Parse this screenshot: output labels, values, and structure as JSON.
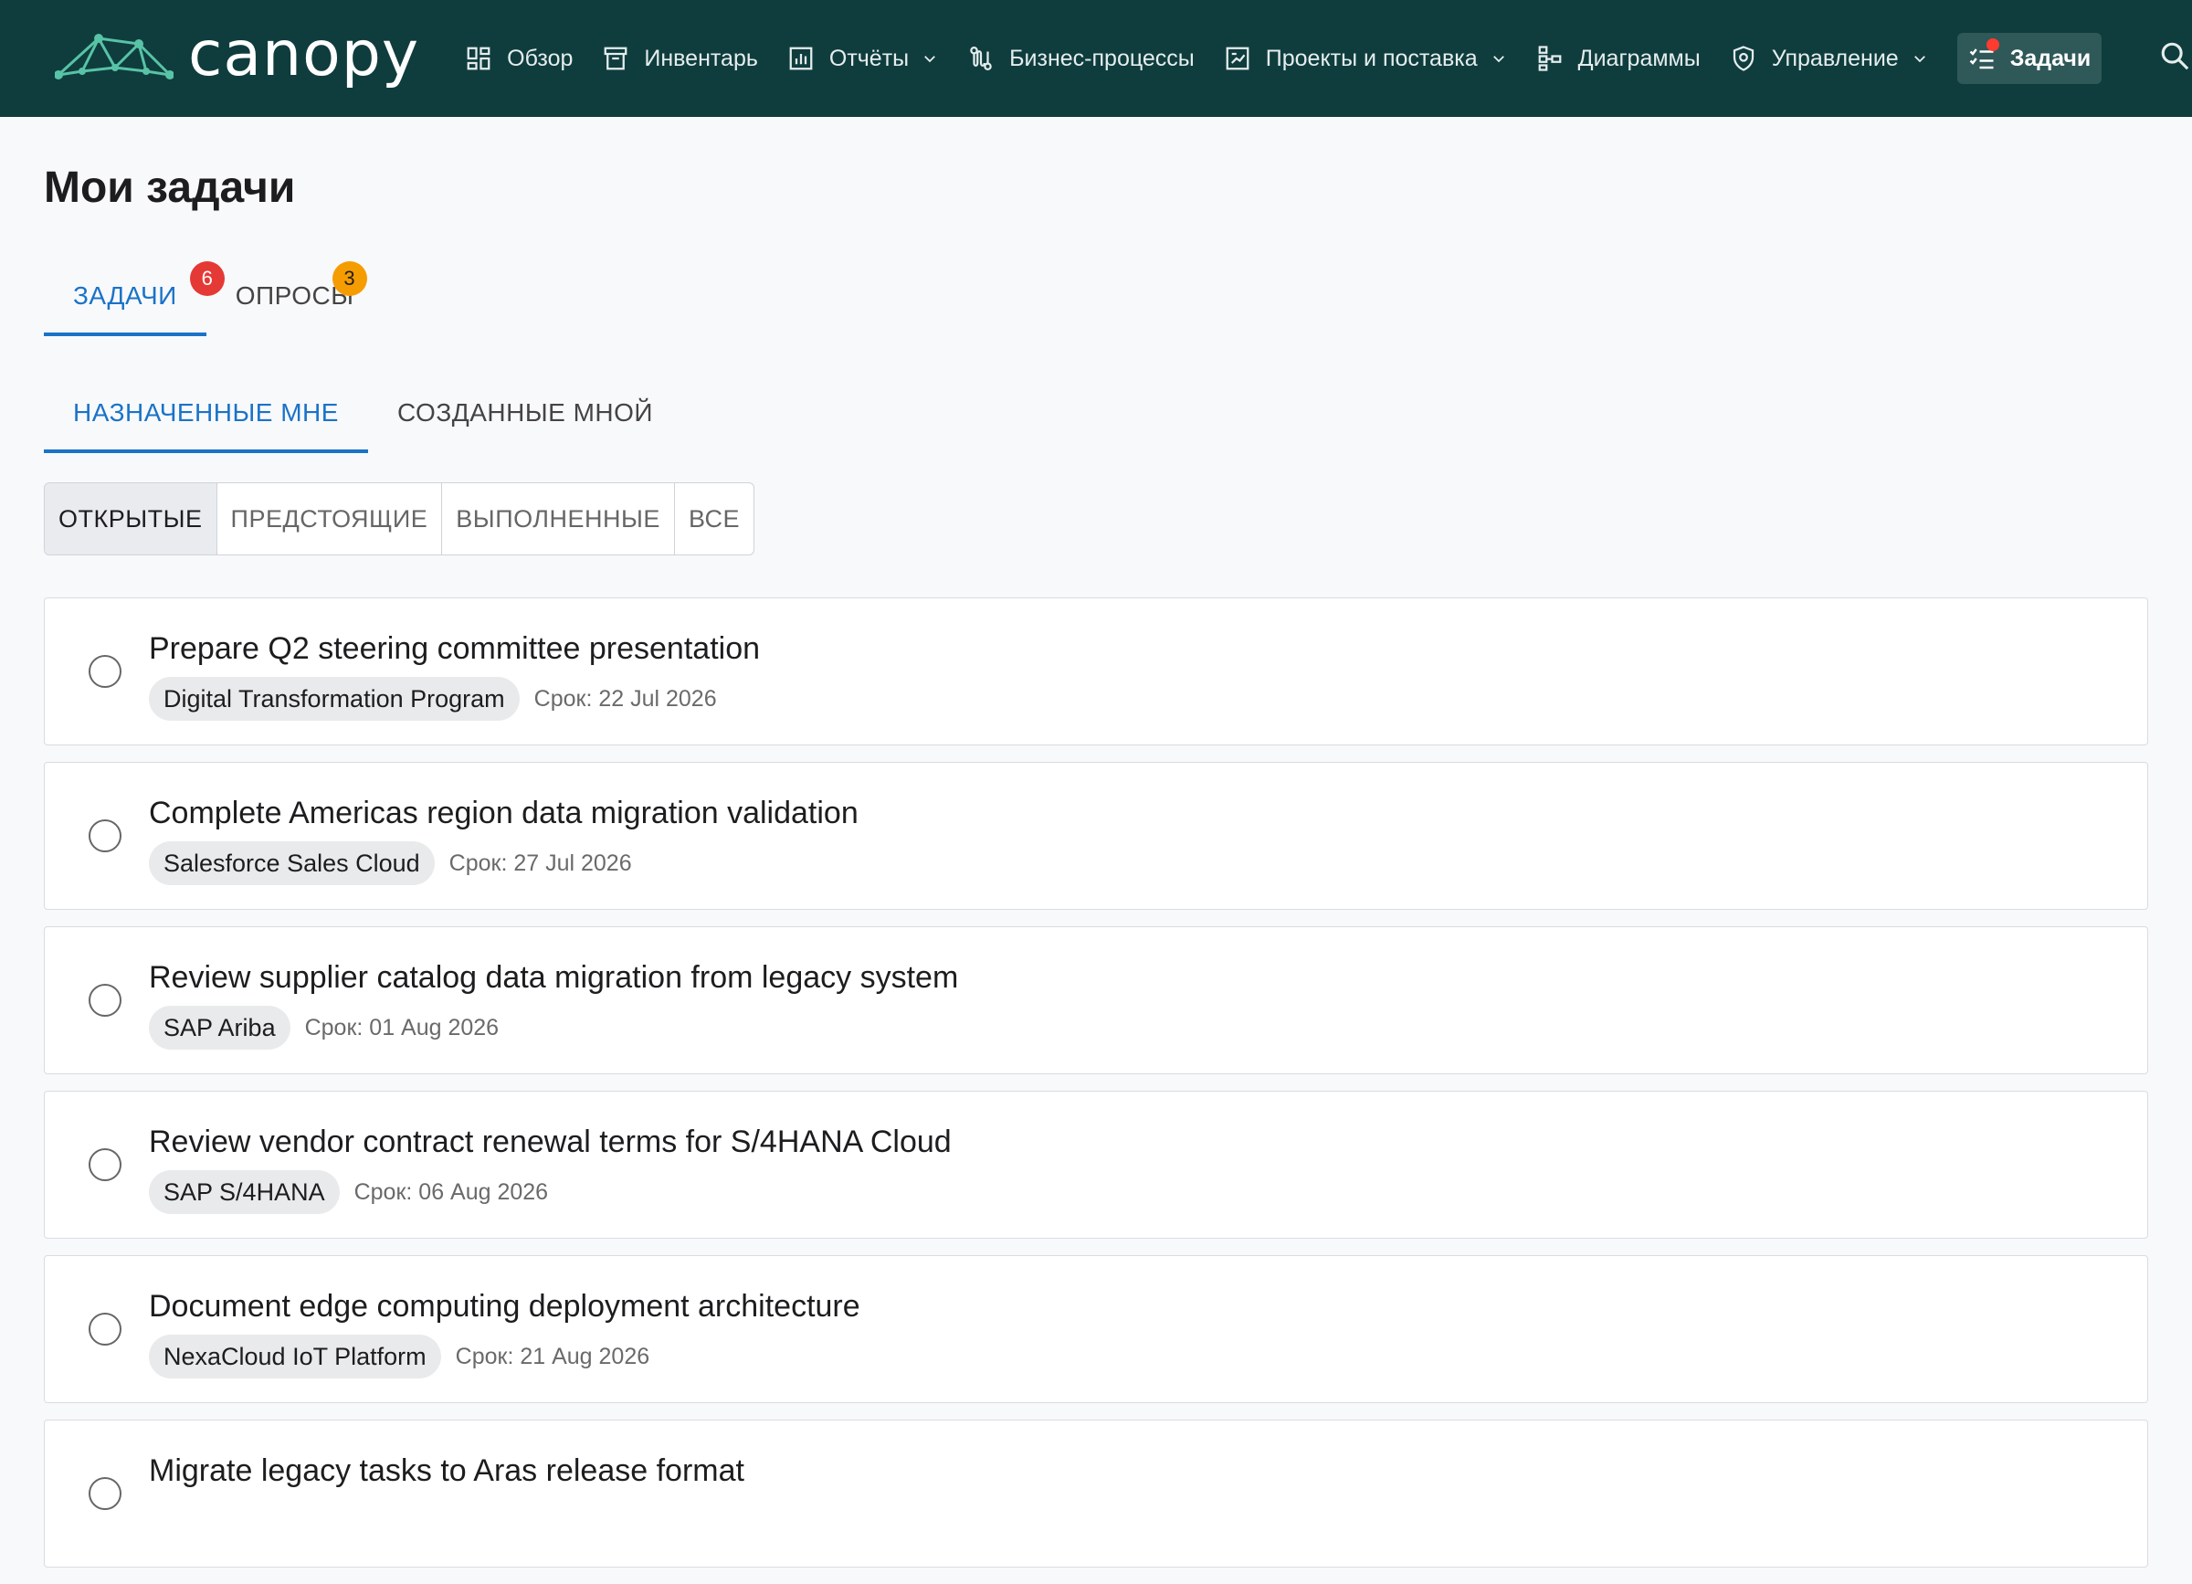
{
  "app": {
    "logo_text": "canopy"
  },
  "nav": {
    "items": [
      {
        "label": "Обзор",
        "icon": "dashboard-icon",
        "has_menu": false
      },
      {
        "label": "Инвентарь",
        "icon": "archive-box-icon",
        "has_menu": false
      },
      {
        "label": "Отчёты",
        "icon": "bar-chart-icon",
        "has_menu": true
      },
      {
        "label": "Бизнес-процессы",
        "icon": "process-flow-icon",
        "has_menu": false
      },
      {
        "label": "Проекты и поставка",
        "icon": "project-board-icon",
        "has_menu": true
      },
      {
        "label": "Диаграммы",
        "icon": "hierarchy-diagram-icon",
        "has_menu": false
      },
      {
        "label": "Управление",
        "icon": "shield-icon",
        "has_menu": true
      }
    ],
    "active": {
      "label": "Задачи",
      "icon": "task-list-icon",
      "notification": true
    },
    "search_icon": "search-icon",
    "colors": {
      "bar": "#0f3d3e",
      "active_bg": "#2f5859",
      "dot": "#ff3b30"
    }
  },
  "page": {
    "title": "Мои задачи"
  },
  "tabs": {
    "tasks": {
      "label": "ЗАДАЧИ",
      "badge": "6"
    },
    "surveys": {
      "label": "ОПРОСЫ",
      "badge": "3"
    }
  },
  "subtabs": {
    "assigned": {
      "label": "НАЗНАЧЕННЫЕ МНЕ"
    },
    "created": {
      "label": "СОЗДАННЫЕ МНОЙ"
    }
  },
  "filters": {
    "open": "ОТКРЫТЫЕ",
    "upcoming": "ПРЕДСТОЯЩИЕ",
    "done": "ВЫПОЛНЕННЫЕ",
    "all": "ВСЕ"
  },
  "tasks": [
    {
      "title": "Prepare Q2 steering committee presentation",
      "tag": "Digital Transformation Program",
      "due": "Срок: 22 Jul 2026"
    },
    {
      "title": "Complete Americas region data migration validation",
      "tag": "Salesforce Sales Cloud",
      "due": "Срок: 27 Jul 2026"
    },
    {
      "title": "Review supplier catalog data migration from legacy system",
      "tag": "SAP Ariba",
      "due": "Срок: 01 Aug 2026"
    },
    {
      "title": "Review vendor contract renewal terms for S/4HANA Cloud",
      "tag": "SAP S/4HANA",
      "due": "Срок: 06 Aug 2026"
    },
    {
      "title": "Document edge computing deployment architecture",
      "tag": "NexaCloud IoT Platform",
      "due": "Срок: 21 Aug 2026"
    },
    {
      "title": "Migrate legacy tasks to Aras release format",
      "tag": "",
      "due": ""
    }
  ],
  "accent_color": "#1a73c8"
}
